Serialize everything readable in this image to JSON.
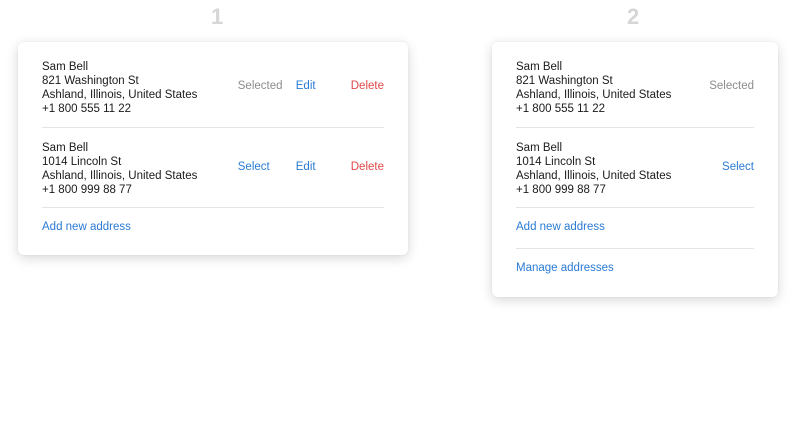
{
  "variants": [
    {
      "number": "1",
      "addresses": [
        {
          "name": "Sam Bell",
          "street": "821 Washington St",
          "city": "Ashland, Illinois, United States",
          "phone": "+1 800 555 11 22",
          "status": "Selected",
          "edit": "Edit",
          "delete": "Delete"
        },
        {
          "name": "Sam Bell",
          "street": "1014 Lincoln St",
          "city": "Ashland, Illinois, United States",
          "phone": "+1 800 999 88 77",
          "select": "Select",
          "edit": "Edit",
          "delete": "Delete"
        }
      ],
      "add_new": "Add new address"
    },
    {
      "number": "2",
      "addresses": [
        {
          "name": "Sam Bell",
          "street": "821 Washington St",
          "city": "Ashland, Illinois, United States",
          "phone": "+1 800 555 11 22",
          "status": "Selected"
        },
        {
          "name": "Sam Bell",
          "street": "1014 Lincoln St",
          "city": "Ashland, Illinois, United States",
          "phone": "+1 800 999 88 77",
          "select": "Select"
        }
      ],
      "add_new": "Add new address",
      "manage": "Manage addresses"
    }
  ],
  "colors": {
    "link": "#2a7bd4",
    "danger": "#e04848",
    "muted": "#8c8c8c",
    "variant_number": "#d6d6d6"
  }
}
